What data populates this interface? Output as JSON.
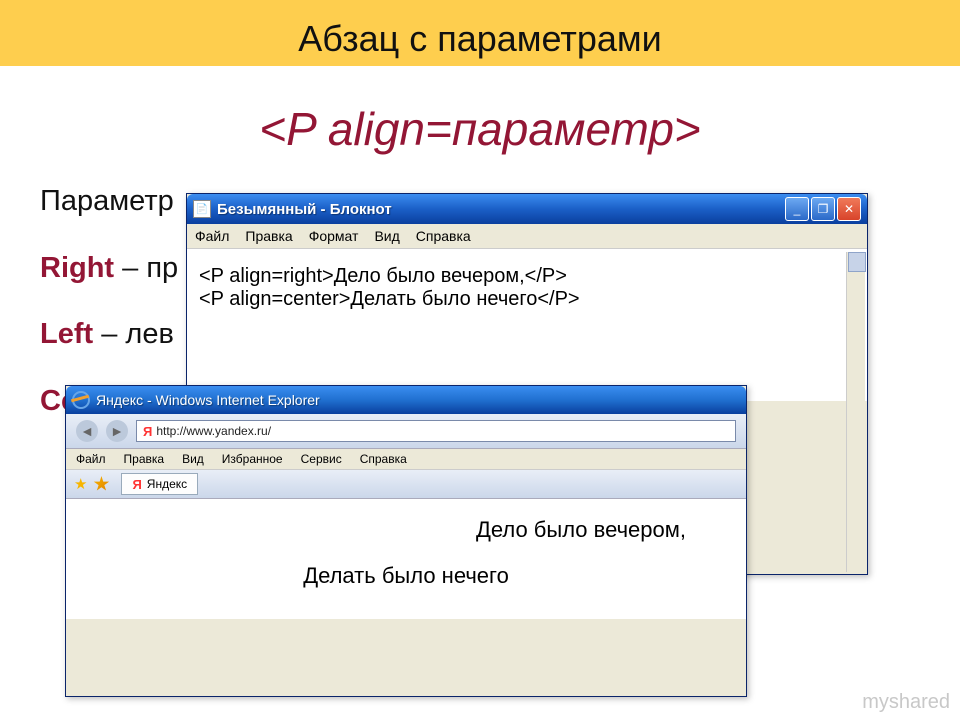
{
  "slide": {
    "title": "Абзац с параметрами",
    "code_example": "<P align=параметр>",
    "param_intro": "Параметр",
    "params": {
      "right_kw": "Right",
      "right_desc": " – пр",
      "left_kw": "Left",
      "left_desc": " – лев",
      "center_kw": "Center",
      "center_desc": ""
    }
  },
  "notepad": {
    "title": "Безымянный - Блокнот",
    "menu": [
      "Файл",
      "Правка",
      "Формат",
      "Вид",
      "Справка"
    ],
    "lines": [
      "<P align=right>Дело было вечером,</P>",
      "<P align=center>Делать было нечего</P>"
    ],
    "buttons": {
      "min": "_",
      "max": "❐",
      "close": "✕"
    }
  },
  "ie": {
    "title": "Яндекс - Windows Internet Explorer",
    "address": "http://www.yandex.ru/",
    "menu": [
      "Файл",
      "Правка",
      "Вид",
      "Избранное",
      "Сервис",
      "Справка"
    ],
    "tab": "Яндекс",
    "content": {
      "line1": "Дело было вечером,",
      "line2": "Делать было нечего"
    }
  },
  "watermark": "myshared"
}
